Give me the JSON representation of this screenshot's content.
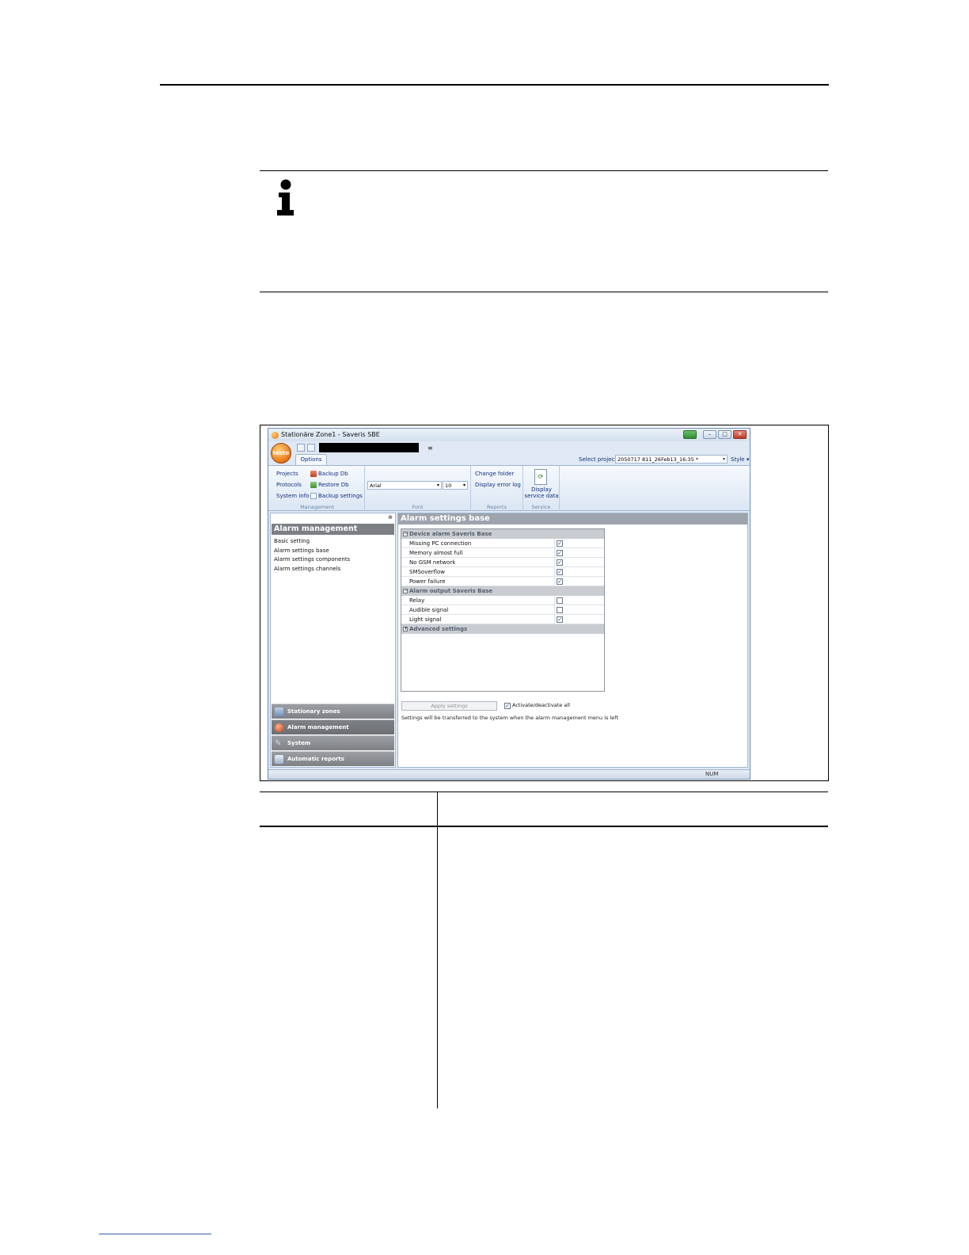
{
  "app": {
    "window_title": "Stationäre Zone1 - Saveris SBE",
    "logo_text": "testo",
    "tab_options": "Options",
    "select_project_label": "Select project",
    "select_project_value": "2050717 811_26Feb13_16:35 *",
    "style_label": "Style",
    "ribbon": {
      "management": {
        "label": "Management",
        "projects": "Projects",
        "protocols": "Protocols",
        "system_info": "System info",
        "backup_db": "Backup Db",
        "restore_db": "Restore Db",
        "backup_settings": "Backup settings"
      },
      "font": {
        "label": "Font",
        "family": "Arial",
        "size": "10"
      },
      "reports": {
        "label": "Reports",
        "change_folder": "Change folder",
        "display_error_log": "Display error log"
      },
      "service": {
        "label": "Service",
        "display_service_data": "Display service data"
      }
    },
    "left_panel": {
      "header": "Alarm management",
      "items": [
        "Basic setting",
        "Alarm settings base",
        "Alarm settings components",
        "Alarm settings channels"
      ],
      "nav": [
        "Stationary zones",
        "Alarm management",
        "System",
        "Automatic reports"
      ]
    },
    "main": {
      "header": "Alarm settings base",
      "categories": [
        {
          "title": "Device alarm Saveris Base",
          "toggle": "−",
          "rows": [
            {
              "label": "Missing PC connection",
              "checked": true
            },
            {
              "label": "Memory almost full",
              "checked": true
            },
            {
              "label": "No GSM network",
              "checked": true
            },
            {
              "label": "SMSoverflow",
              "checked": true
            },
            {
              "label": "Power failure",
              "checked": true
            }
          ]
        },
        {
          "title": "Alarm output Saveris Base",
          "toggle": "−",
          "rows": [
            {
              "label": "Relay",
              "checked": false
            },
            {
              "label": "Audible signal",
              "checked": false
            },
            {
              "label": "Light signal",
              "checked": true
            }
          ]
        },
        {
          "title": "Advanced settings",
          "toggle": "+",
          "rows": []
        }
      ],
      "apply_button": "Apply settings",
      "activate_all": "Activate/deactivate all",
      "activate_all_checked": true,
      "note": "Settings will be transferred to the system when the alarm management menu is left"
    },
    "status": "NUM"
  }
}
